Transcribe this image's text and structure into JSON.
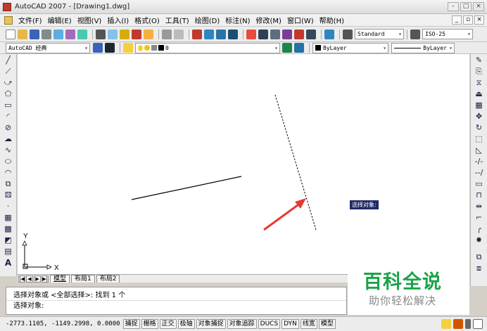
{
  "window": {
    "title": "AutoCAD 2007 - [Drawing1.dwg]",
    "controls": [
      "–",
      "□",
      "×"
    ]
  },
  "menubar": {
    "items": [
      "文件(F)",
      "编辑(E)",
      "视图(V)",
      "插入(I)",
      "格式(O)",
      "工具(T)",
      "绘图(D)",
      "标注(N)",
      "修改(M)",
      "窗口(W)",
      "帮助(H)"
    ],
    "doc_controls": [
      "_",
      "▫",
      "×"
    ]
  },
  "toolbar1": {
    "text_style": "Standard",
    "dim_style": "ISO-25"
  },
  "toolbar2": {
    "workspace": "AutoCAD 经典",
    "layer": "0",
    "color": "ByLayer",
    "linetype": "ByLayer"
  },
  "canvas": {
    "tooltip": "选择对象:",
    "ucs_x": "X",
    "ucs_y": "Y"
  },
  "tabs": {
    "items": [
      "模型",
      "布局1",
      "布局2"
    ],
    "active": "模型"
  },
  "command": {
    "line1": "选择对象或 <全部选择>:  找到 1 个",
    "line2": "选择对象:"
  },
  "status": {
    "coords": "-2773.1105, -1149.2998, 0.0000",
    "buttons": [
      "捕捉",
      "栅格",
      "正交",
      "极轴",
      "对象捕捉",
      "对象追踪",
      "DUCS",
      "DYN",
      "线宽",
      "模型"
    ]
  },
  "watermark": {
    "main": "百科全说",
    "sub": "助你轻松解决"
  },
  "colors": {
    "canvas_bg": "#ffffff",
    "tooltip_bg": "#1f2a66",
    "arrow": "#e53935",
    "watermark": "#1aa34a"
  }
}
